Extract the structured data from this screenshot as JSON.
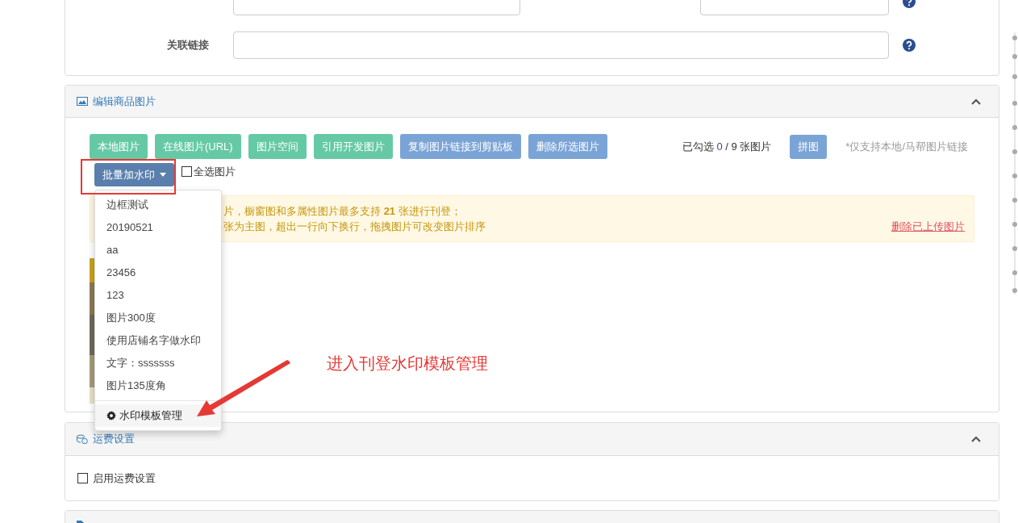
{
  "top_fields": {
    "row2": {
      "label": "关联链接"
    }
  },
  "image_panel": {
    "title": "编辑商品图片",
    "buttons": [
      {
        "label": "本地图片",
        "kind": "source"
      },
      {
        "label": "在线图片(URL)",
        "kind": "source"
      },
      {
        "label": "图片空间",
        "kind": "source"
      },
      {
        "label": "引用开发图片",
        "kind": "source"
      },
      {
        "label": "复制图片链接到剪贴板",
        "kind": "action"
      },
      {
        "label": "删除所选图片",
        "kind": "action"
      }
    ],
    "selection": {
      "prefix": "已勾选",
      "count": "0",
      "suffix": "/ 9 张图片"
    },
    "collage_button": "拼图",
    "note": "*仅支持本地/马帮图片链接",
    "watermark_button": {
      "label": "批量加水印",
      "expanded": true
    },
    "select_all": {
      "label": "全选图片",
      "checked": false
    },
    "notice": {
      "lines": [
        "片，橱窗图和多属性图片最多支持 **21** 张进行刊登；",
        "张为主图，超出一行向下换行，拖拽图片可改变图片排序"
      ],
      "link": "删除已上传图片"
    },
    "watermark_menu": {
      "items": [
        "边框测试",
        "20190521",
        "aa",
        "23456",
        "123",
        "图片300度",
        "使用店铺名字做水印",
        "文字：sssssss",
        "图片135度角"
      ],
      "manage": "水印模板管理"
    }
  },
  "annotation": {
    "text": "进入刊登水印模板管理"
  },
  "shipping_panel": {
    "title": "运费设置",
    "enable": {
      "label": "启用运费设置",
      "checked": false
    }
  }
}
